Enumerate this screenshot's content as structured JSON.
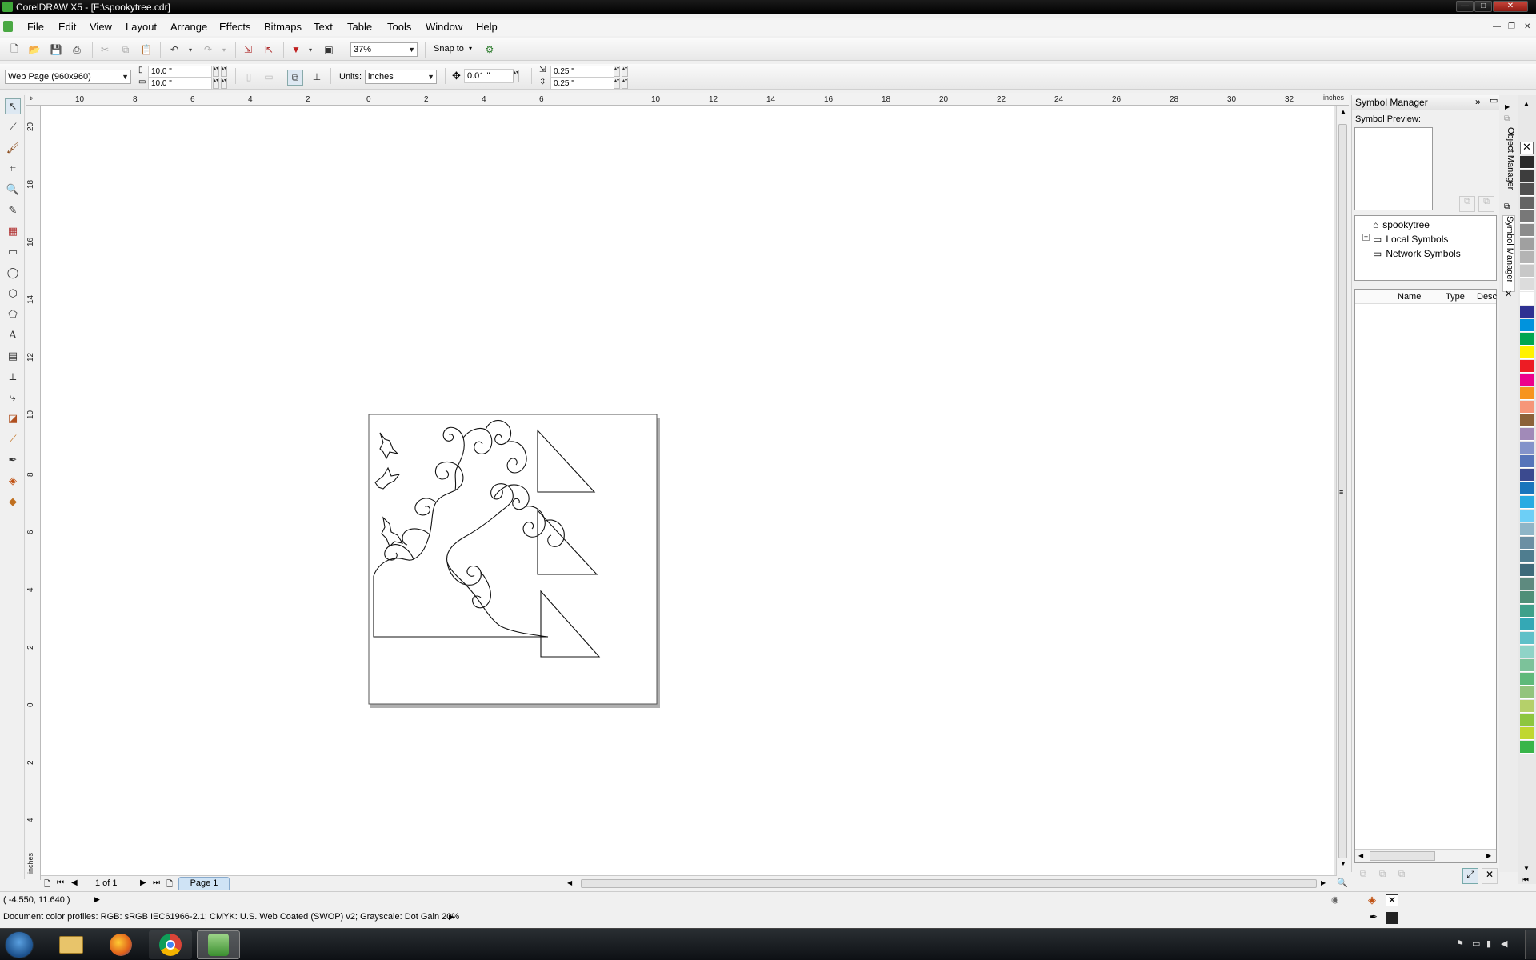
{
  "window": {
    "title": "CorelDRAW X5 - [F:\\spookytree.cdr]"
  },
  "menu": [
    "File",
    "Edit",
    "View",
    "Layout",
    "Arrange",
    "Effects",
    "Bitmaps",
    "Text",
    "Table",
    "Tools",
    "Window",
    "Help"
  ],
  "toolbar": {
    "zoom": "37%",
    "snap_to": "Snap to"
  },
  "property_bar": {
    "page_preset": "Web Page (960x960)",
    "width": "10.0 \"",
    "height": "10.0 \"",
    "units_label": "Units:",
    "units": "inches",
    "nudge": "0.01 \"",
    "dup_x": "0.25 \"",
    "dup_y": "0.25 \""
  },
  "ruler": {
    "h_ticks": [
      "10",
      "8",
      "6",
      "4",
      "2",
      "0",
      "2",
      "4",
      "6",
      "10",
      "12",
      "14",
      "16",
      "18",
      "20",
      "22",
      "24",
      "26",
      "28",
      "30",
      "32"
    ],
    "h_unit": "inches",
    "v_ticks": [
      "20",
      "18",
      "16",
      "14",
      "12",
      "10",
      "8",
      "6",
      "4",
      "2",
      "0",
      "2",
      "4"
    ],
    "v_unit": "inches"
  },
  "docker": {
    "title": "Symbol Manager",
    "preview_label": "Symbol Preview:",
    "tree": [
      "spookytree",
      "Local Symbols",
      "Network Symbols"
    ],
    "columns": [
      "Name",
      "Type",
      "Desc"
    ],
    "side_tabs": [
      "Object Manager",
      "Symbol Manager"
    ]
  },
  "page_nav": {
    "counter": "1 of 1",
    "page_tab": "Page 1"
  },
  "status": {
    "cursor": "( -4.550, 11.640 )",
    "color_profiles": "Document color profiles: RGB: sRGB IEC61966-2.1; CMYK: U.S. Web Coated (SWOP) v2; Grayscale: Dot Gain 20%"
  },
  "palette": [
    "#2b2b2b",
    "#3d3d3d",
    "#505050",
    "#646464",
    "#787878",
    "#8c8c8c",
    "#a0a0a0",
    "#b4b4b4",
    "#c8c8c8",
    "#dcdcdc",
    "#ffffff",
    "#2e3192",
    "#0093dd",
    "#00a651",
    "#fff200",
    "#ed1c24",
    "#ec008c",
    "#f7941d",
    "#f69679",
    "#8c6239",
    "#a18ab8",
    "#8393ca",
    "#5674b9",
    "#3b4a8f",
    "#1a75bc",
    "#29abe2",
    "#6dcff6",
    "#8fb5c7",
    "#6c8fa3",
    "#4f7d8f",
    "#3e6a7a",
    "#5e8a7f",
    "#4f8f78",
    "#3fa08a",
    "#34a8b5",
    "#5fc0c8",
    "#8fd3c7",
    "#7cc29a",
    "#5fb97a",
    "#93c47d",
    "#b5d06a",
    "#8dc63f",
    "#c0d72f",
    "#39b54a"
  ],
  "taskbar": [
    "start",
    "explorer",
    "firefox",
    "chrome",
    "coreldraw"
  ]
}
